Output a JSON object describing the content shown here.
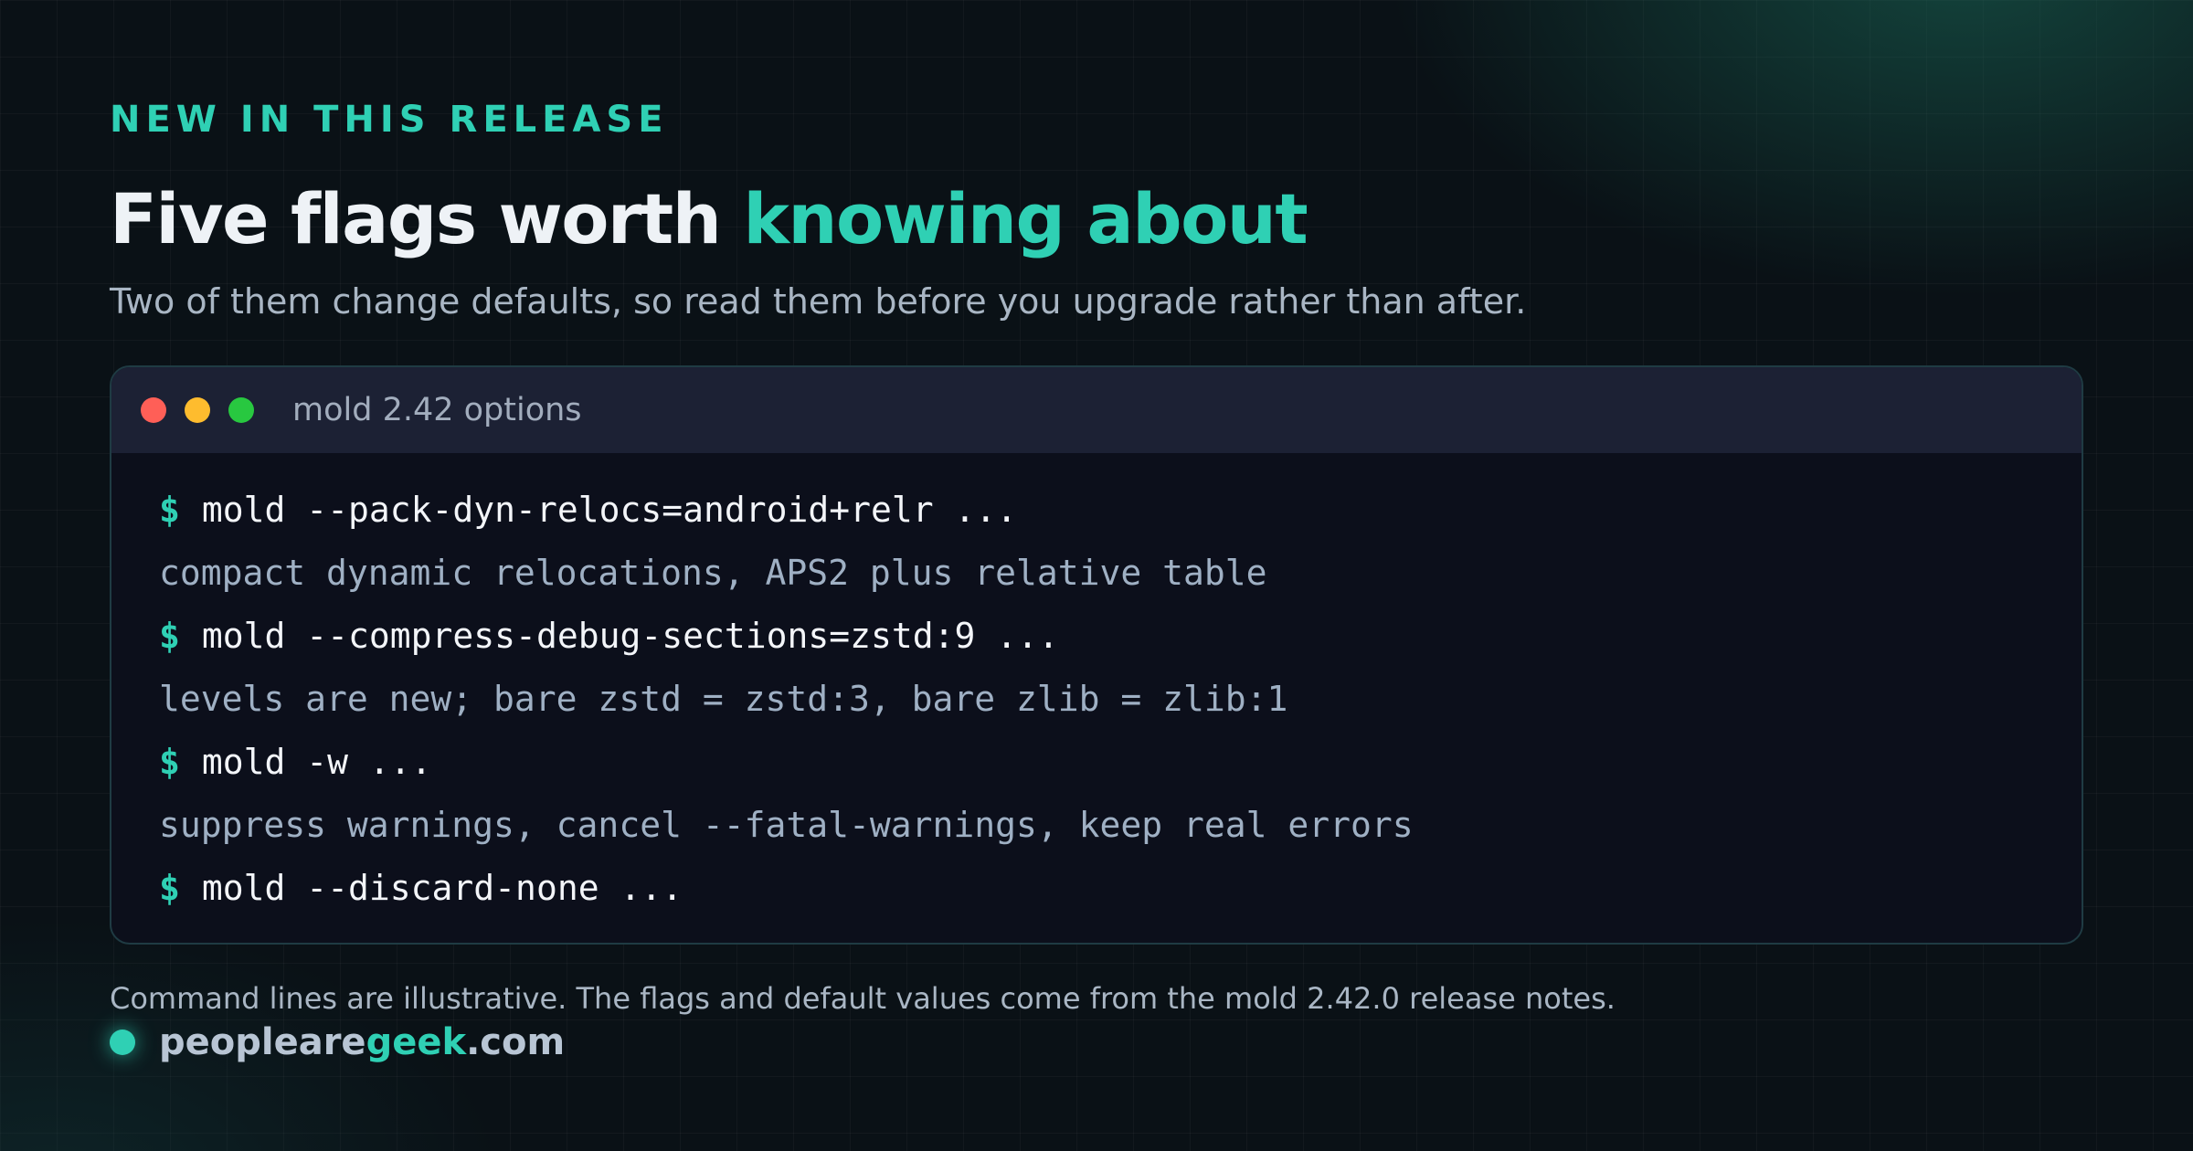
{
  "eyebrow": "NEW IN THIS RELEASE",
  "headline": {
    "plain": "Five flags worth ",
    "accent": "knowing about"
  },
  "subheadline": "Two of them change defaults, so read them before you upgrade rather than after.",
  "terminal": {
    "title": "mold 2.42 options",
    "prompt": "$",
    "lines": [
      {
        "kind": "cmd",
        "text": "mold --pack-dyn-relocs=android+relr ..."
      },
      {
        "kind": "desc",
        "text": "compact dynamic relocations, APS2 plus relative table"
      },
      {
        "kind": "cmd",
        "text": "mold --compress-debug-sections=zstd:9 ..."
      },
      {
        "kind": "desc",
        "text": "levels are new; bare zstd = zstd:3, bare zlib = zlib:1"
      },
      {
        "kind": "cmd",
        "text": "mold -w ..."
      },
      {
        "kind": "desc",
        "text": "suppress warnings, cancel --fatal-warnings, keep real errors"
      },
      {
        "kind": "cmd",
        "text": "mold --discard-none ..."
      }
    ]
  },
  "footnote": "Command lines are illustrative. The flags and default values come from the mold 2.42.0 release notes.",
  "brand": {
    "before": "peopleare",
    "highlight": "geek",
    "after": ".com"
  },
  "colors": {
    "accent": "#2fd0b4",
    "background": "#0a1116",
    "terminal_bg": "#0c0f1b",
    "terminal_header": "#1c2134",
    "dot_red": "#ff5f57",
    "dot_yellow": "#febc2e",
    "dot_green": "#28c840"
  }
}
